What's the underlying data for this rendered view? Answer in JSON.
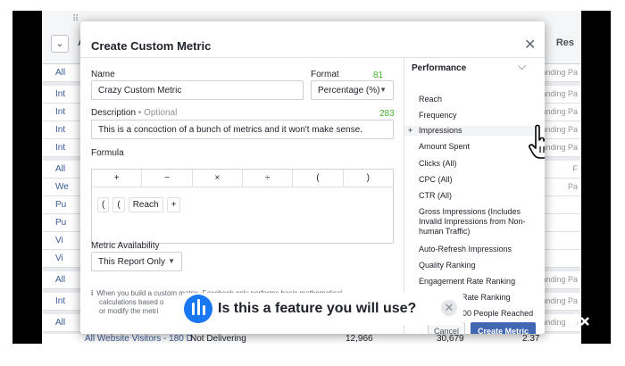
{
  "background": {
    "header_col_a": "A",
    "header_col_results": "Res",
    "rows": [
      {
        "left": "All",
        "right": "Landing Pa"
      },
      {
        "left": "Int",
        "right": "Landing Pa"
      },
      {
        "left": "Int",
        "right": "Landing Pa"
      },
      {
        "left": "Int",
        "right": "Landing Pa"
      },
      {
        "left": "Int",
        "right": "Landing Pa"
      },
      {
        "left": "All",
        "right": "F"
      },
      {
        "left": "We",
        "right": "Pa"
      },
      {
        "left": "Pu",
        "right": ""
      },
      {
        "left": "Pu",
        "right": ""
      },
      {
        "left": "Vi",
        "right": ""
      },
      {
        "left": "Vi",
        "right": ""
      },
      {
        "left": "All",
        "right": "Landing Pa"
      },
      {
        "left": "Int",
        "right": "Landing Pa"
      },
      {
        "left": "All",
        "right": "Landing Pa"
      }
    ],
    "footer_row": {
      "name": "All Website Visitors - 180 D",
      "status": "Not Delivering",
      "col1": "12,966",
      "col2": "30,679",
      "col3": "2.37"
    }
  },
  "modal": {
    "title": "Create Custom Metric",
    "name_label": "Name",
    "name_count": "81",
    "name_value": "Crazy Custom Metric",
    "format_label": "Format",
    "format_value": "Percentage (%)",
    "description_label": "Description",
    "description_optional": " • Optional",
    "description_count": "283",
    "description_value": "This is a concoction of a bunch of metrics and it won't make sense.",
    "formula_label": "Formula",
    "operators": [
      "+",
      "−",
      "×",
      "÷",
      "(",
      ")"
    ],
    "formula_tokens": [
      "(",
      "(",
      "Reach",
      "+"
    ],
    "availability_label": "Metric Availability",
    "availability_value": "This Report Only",
    "info_text_line1": "When you build a custom metric, Facebook only performs basic mathematical",
    "info_text_line2": "calculations based o",
    "info_text_line3": "or modify the metri",
    "cancel_label": "Cancel",
    "create_label": "Create Metric"
  },
  "panel": {
    "heading": "Performance",
    "items": [
      "Reach",
      "Frequency",
      "Impressions",
      "Amount Spent",
      "Clicks (All)",
      "CPC (All)",
      "CTR (All)",
      "Gross Impressions (Includes Invalid Impressions from Non-human Traffic)",
      "Auto-Refresh Impressions",
      "Quality Ranking",
      "Engagement Rate Ranking",
      "Conversion Rate Ranking",
      "Cost per 1,000 People Reached"
    ],
    "highlighted_item": "Impressions"
  },
  "survey": {
    "question": "Is this a feature you will use?"
  },
  "colors": {
    "accent": "#4267b2",
    "count": "#42b72a",
    "survey_icon": "#1877f2"
  }
}
